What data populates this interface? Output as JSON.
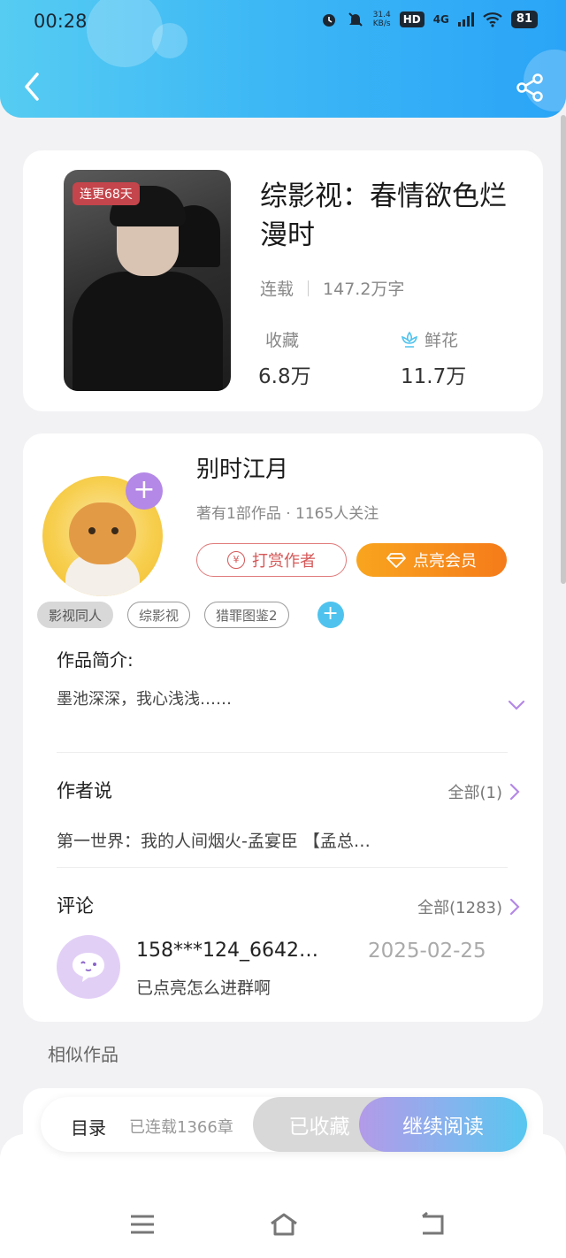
{
  "status_bar": {
    "time": "00:28",
    "net_speed_value": "31.4",
    "net_speed_unit": "KB/s",
    "hd": "HD",
    "network": "4G",
    "battery": "81"
  },
  "book": {
    "cover_badge": "连更68天",
    "title": "综影视：春情欲色烂漫时",
    "status": "连载",
    "word_count": "147.2万字",
    "favorites_label": "收藏",
    "favorites_value": "6.8万",
    "flowers_label": "鲜花",
    "flowers_value": "11.7万"
  },
  "author": {
    "name": "别时江月",
    "info": "著有1部作品 · 1165人关注",
    "tip_label": "打赏作者",
    "tip_icon": "yen-icon",
    "vip_label": "点亮会员",
    "vip_icon": "diamond-icon"
  },
  "tags": [
    "影视同人",
    "综影视",
    "猎罪图鉴2"
  ],
  "intro": {
    "title": "作品简介:",
    "text": "墨池深深，我心浅浅……"
  },
  "author_says": {
    "title": "作者说",
    "more": "全部(1)",
    "text": "第一世界：我的人间烟火-孟宴臣 【孟总…"
  },
  "comments": {
    "title": "评论",
    "more": "全部(1283)",
    "items": [
      {
        "user": "158***124_6642…",
        "date": "2025-02-25",
        "text": "已点亮怎么进群啊"
      }
    ]
  },
  "similar_title": "相似作品",
  "action_bar": {
    "toc": "目录",
    "toc_sub": "已连载1366章",
    "collected": "已收藏",
    "continue": "继续阅读"
  },
  "colors": {
    "header_start": "#56ccf2",
    "header_end": "#2aa4f6",
    "vip_orange": "#f57b1a",
    "tip_red": "#d65858",
    "accent_purple": "#b488e6"
  }
}
